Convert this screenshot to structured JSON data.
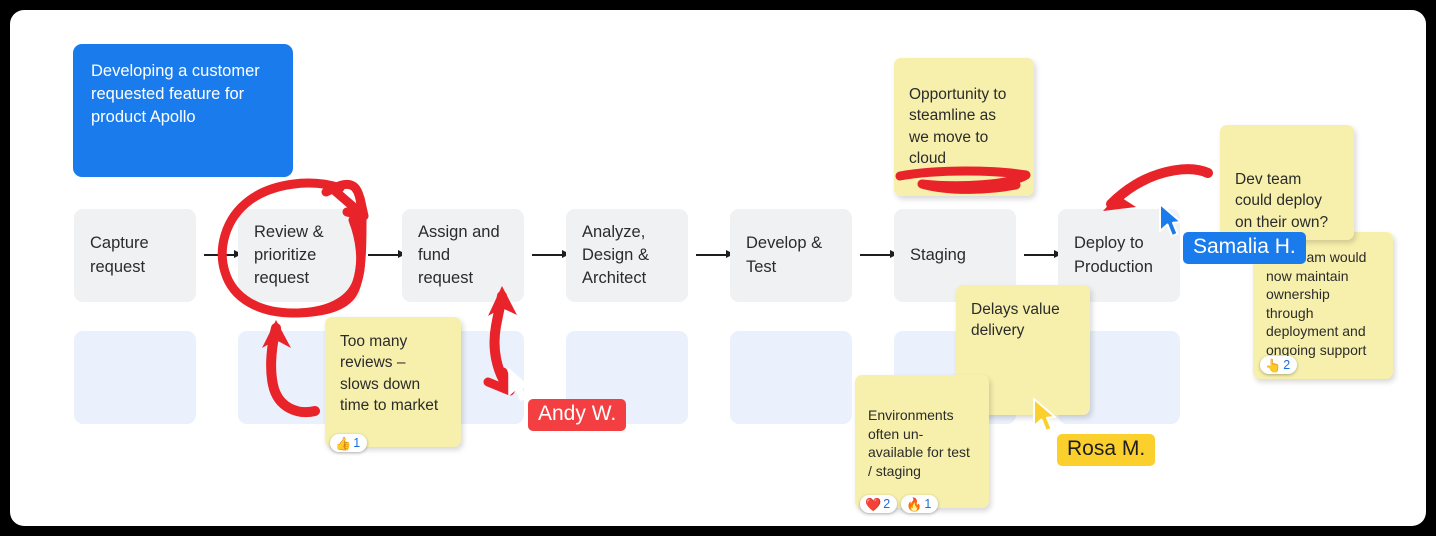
{
  "board": {
    "background": "#000000",
    "canvas_color": "#ffffff",
    "accent_blue": "#1a7cec",
    "sticky_yellow": "#f7f0ad",
    "process_box_color": "#f0f1f3",
    "sub_box_color": "#eaf1fc",
    "ink_color": "#e8232a"
  },
  "title_card": {
    "text": "Developing a customer requested feature for product Apollo",
    "color": "#1a7cec"
  },
  "process": {
    "steps": [
      {
        "label": "Capture request"
      },
      {
        "label": "Review & prioritize request"
      },
      {
        "label": "Assign and fund request"
      },
      {
        "label": "Analyze, Design & Architect"
      },
      {
        "label": "Develop & Test"
      },
      {
        "label": "Staging"
      },
      {
        "label": "Deploy to Production"
      }
    ]
  },
  "notes": [
    {
      "id": "too-many-reviews",
      "text": "Too many reviews – slows down time to market",
      "reactions": [
        {
          "emoji": "👍",
          "name": "thumbs-up",
          "count": "1"
        }
      ]
    },
    {
      "id": "steamline-cloud",
      "text": "Opportunity to steamline as we move to cloud",
      "reactions": []
    },
    {
      "id": "dev-team-deploy",
      "text": "Dev team could deploy on their own?",
      "reactions": []
    },
    {
      "id": "dev-team-ownership",
      "text": "Dev team would now maintain ownership through deployment and ongoing support",
      "reactions": [
        {
          "emoji": "👆",
          "name": "point-up",
          "count": "2"
        }
      ]
    },
    {
      "id": "delays-value",
      "text": "Delays value delivery",
      "reactions": []
    },
    {
      "id": "environments-unavailable",
      "text": "Environments often un-available for test / staging",
      "reactions": [
        {
          "emoji": "❤️",
          "name": "heart",
          "count": "2"
        },
        {
          "emoji": "🔥",
          "name": "fire",
          "count": "1"
        }
      ]
    }
  ],
  "collaborators": [
    {
      "name": "Andy W.",
      "color": "#f33f42",
      "cursor_color": "#ffffff"
    },
    {
      "name": "Samalia H.",
      "color": "#1a7cec",
      "cursor_color": "#1a7cec"
    },
    {
      "name": "Rosa M.",
      "color": "#fcd02c",
      "cursor_color": "#fcd02c"
    }
  ],
  "annotations": [
    {
      "name": "circle-around-review-step",
      "shape": "hand-drawn-ellipse"
    },
    {
      "name": "arrow-up-to-review-step",
      "shape": "curved-arrow"
    },
    {
      "name": "arrow-up-to-assign-step",
      "shape": "curved-arrow"
    },
    {
      "name": "underline-cloud-note",
      "shape": "scribble-underline"
    },
    {
      "name": "arrow-to-deploy-step",
      "shape": "curved-arrow"
    }
  ]
}
